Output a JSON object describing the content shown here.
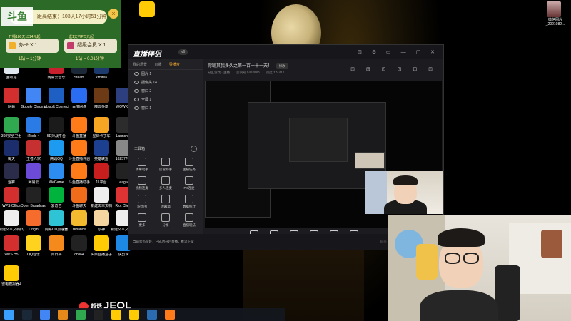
{
  "reward": {
    "brand": "斗鱼",
    "timer_text": "距离结束：103天17小时51分钟",
    "close": "×",
    "tag_left": "开播180天1314元起",
    "tag_right": "送1天VIP/5元起",
    "card_left": "办卡 X 1",
    "card_right": "超级会员 X 1",
    "rate_left": "1钻 = 1分钟",
    "rate_right": "1钻 = 0.01分钟",
    "colors": {
      "bg": "#2b6b27",
      "card": "#e9e5cf",
      "accent": "#f1c64b"
    }
  },
  "desktop_icons": [
    {
      "label": "回收站",
      "color": "#dfe6ee"
    },
    {
      "label": "网易云音乐",
      "color": "#c8202d"
    },
    {
      "label": "Steam",
      "color": "#1b2838"
    },
    {
      "label": "kimitea",
      "color": "#1d3a6e"
    },
    {
      "label": "网易",
      "color": "#d42f2f"
    },
    {
      "label": "Google Chrome",
      "color": "#4285f4"
    },
    {
      "label": "Ubisoft Connect",
      "color": "#1d5fc3"
    },
    {
      "label": "百度网盘",
      "color": "#2a6cf2"
    },
    {
      "label": "魔兽争霸",
      "color": "#6c3b15"
    },
    {
      "label": "WOWKIT",
      "color": "#2d3f7f"
    },
    {
      "label": "360安全卫士",
      "color": "#2fa84f"
    },
    {
      "label": "iTools 4",
      "color": "#2b7be6"
    },
    {
      "label": "5E对战平台",
      "color": "#1b1b1b"
    },
    {
      "label": "斗鱼直播",
      "color": "#ff7b1a"
    },
    {
      "label": "星际卡丁车",
      "color": "#f6a623"
    },
    {
      "label": "Launcher",
      "color": "#2c2c2c"
    },
    {
      "label": "梅天",
      "color": "#1b2e6b"
    },
    {
      "label": "王者人家",
      "color": "#c63030"
    },
    {
      "label": "腾讯QQ",
      "color": "#1d9bf0"
    },
    {
      "label": "斗鱼直播伴侣",
      "color": "#ff7b1a"
    },
    {
      "label": "英雄联盟",
      "color": "#1c3f8f"
    },
    {
      "label": "16257767",
      "color": "#888"
    },
    {
      "label": "烟雾",
      "color": "#2b2b4a"
    },
    {
      "label": "网易云",
      "color": "#6b4bd8"
    },
    {
      "label": "WeGame",
      "color": "#2c8cf0"
    },
    {
      "label": "斗鱼直播助手",
      "color": "#ff7b1a"
    },
    {
      "label": "11平台",
      "color": "#c81e1e"
    },
    {
      "label": "League",
      "color": "#222"
    },
    {
      "label": "WPS Office",
      "color": "#d42f2f"
    },
    {
      "label": "Open Broadcast",
      "color": "#222"
    },
    {
      "label": "爱奇艺",
      "color": "#00b33c"
    },
    {
      "label": "斗鱼聊天",
      "color": "#f06b1a"
    },
    {
      "label": "新建文本文档",
      "color": "#eee"
    },
    {
      "label": "Riot Client",
      "color": "#d33"
    },
    {
      "label": "新建文本文档(3)",
      "color": "#eee"
    },
    {
      "label": "Origin",
      "color": "#f56c2d"
    },
    {
      "label": "网易UU加速器",
      "color": "#2ec4d6"
    },
    {
      "label": "Binance",
      "color": "#f3ba2f"
    },
    {
      "label": "原神",
      "color": "#f5d6a0"
    },
    {
      "label": "新建文本文档(4)",
      "color": "#eee"
    },
    {
      "label": "WPS H5",
      "color": "#d42f2f"
    },
    {
      "label": "QQ音乐",
      "color": "#ffd21f"
    },
    {
      "label": "向日葵",
      "color": "#f48a1c"
    },
    {
      "label": "obs64",
      "color": "#222"
    },
    {
      "label": "头条直播盒子",
      "color": "#ffcb05"
    },
    {
      "label": "快剪辑",
      "color": "#1e88e5"
    },
    {
      "label": "雷电模拟器4",
      "color": "#ffcb05"
    }
  ],
  "broadcaster": {
    "logo": "直播伴侣",
    "version": "v6",
    "win_buttons": "⊡ ⚙ ▭ — ▢ ✕",
    "tabs": [
      "我的场景",
      "直播",
      "导播台"
    ],
    "add": "+",
    "scenes": [
      "图片 1",
      "摄像头 14",
      "窗口 2",
      "全屏 1",
      "窗口 1"
    ],
    "tools_title": "工具箱",
    "tools": [
      "弹幕助手",
      "房管助手",
      "主播任务",
      "视频连麦",
      "多人连麦",
      "PK连麦",
      "粉丝团",
      "弹幕墙",
      "数据统计",
      "更多",
      "分享",
      "直播玩法"
    ],
    "room_title": "你聪其我多久之第一百一十一天！",
    "room_btn": "修改",
    "room_meta": [
      "分区游戏 · 主播",
      "房间号 5462980",
      "热度 174412"
    ],
    "header_icons": "⊡ ⊞ ⊡ ⊡ ⊡ ⊡",
    "controls": [
      "直播弹幕",
      "摄像头",
      "多机位",
      "多窗口",
      "麦克风",
      "扬声器"
    ],
    "status_left": "当前状态良好，已成功开启直播，推流正常",
    "status_right": "码率 0Kbps · FPS 0 · 直播时长 00:00:00"
  },
  "avatar_label": "微信图片_2021082...",
  "watermark": {
    "prefix": "超话",
    "name": "JEOL"
  },
  "taskbar_icons": [
    "start",
    "steam",
    "chrome",
    "browser",
    "wechat",
    "obs",
    "app1",
    "app2",
    "app3",
    "douyu"
  ]
}
